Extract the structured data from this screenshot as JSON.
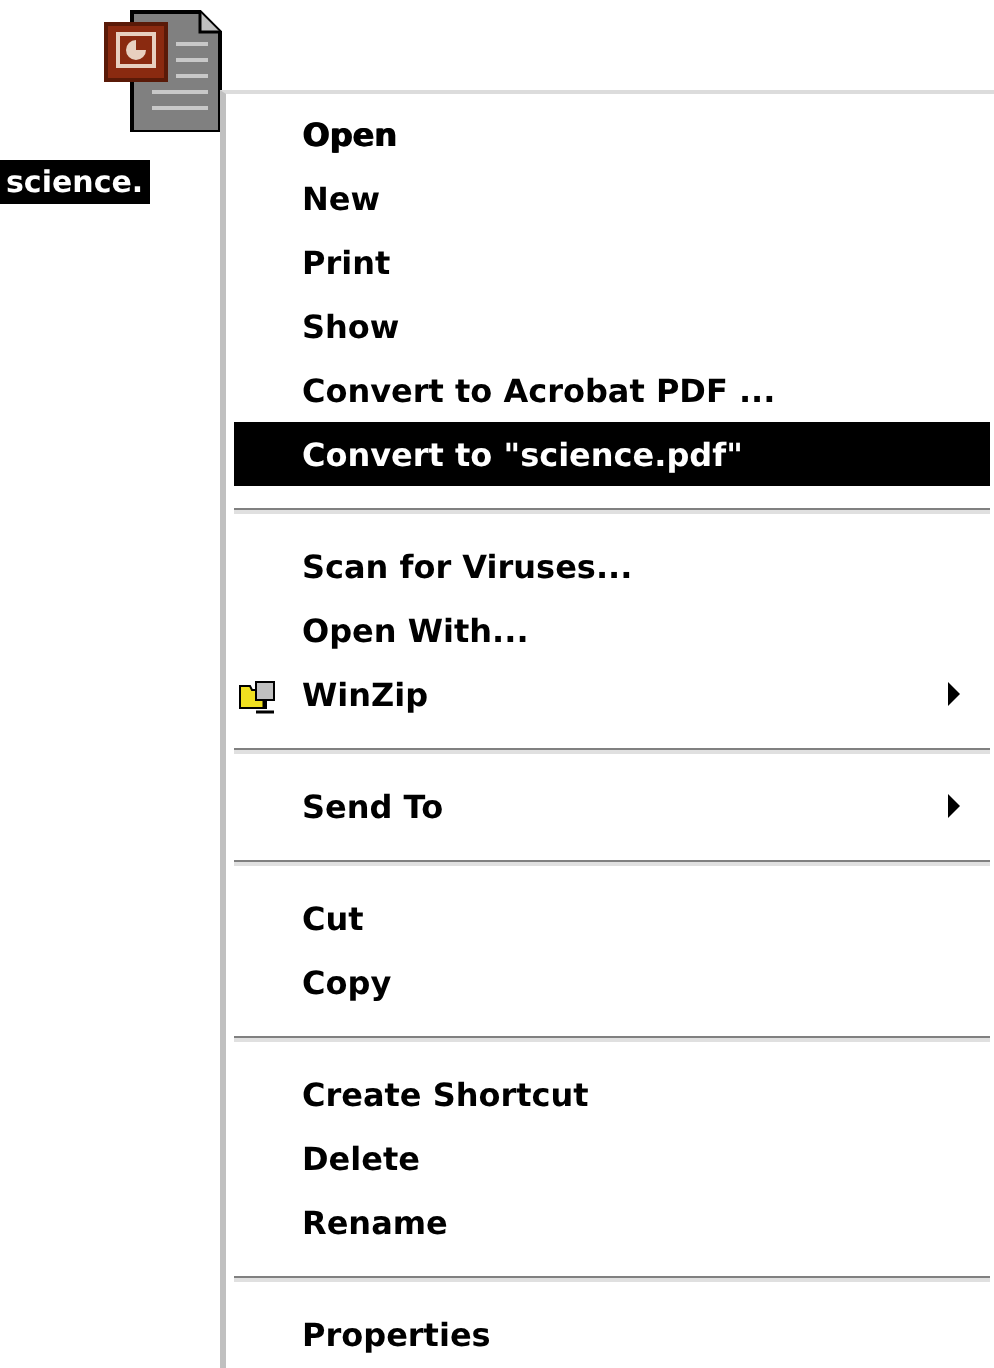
{
  "file": {
    "label": "science.",
    "selected": true
  },
  "context_menu": {
    "items": [
      {
        "kind": "item",
        "label": "Open",
        "default": true,
        "selected": false,
        "submenu": false,
        "icon": false
      },
      {
        "kind": "item",
        "label": "New",
        "default": false,
        "selected": false,
        "submenu": false,
        "icon": false
      },
      {
        "kind": "item",
        "label": "Print",
        "default": false,
        "selected": false,
        "submenu": false,
        "icon": false
      },
      {
        "kind": "item",
        "label": "Show",
        "default": false,
        "selected": false,
        "submenu": false,
        "icon": false
      },
      {
        "kind": "item",
        "label": "Convert to Acrobat PDF ...",
        "default": false,
        "selected": false,
        "submenu": false,
        "icon": false
      },
      {
        "kind": "item",
        "label": "Convert to \"science.pdf\"",
        "default": false,
        "selected": true,
        "submenu": false,
        "icon": false
      },
      {
        "kind": "separator"
      },
      {
        "kind": "item",
        "label": "Scan for Viruses...",
        "default": false,
        "selected": false,
        "submenu": false,
        "icon": false
      },
      {
        "kind": "item",
        "label": "Open With...",
        "default": false,
        "selected": false,
        "submenu": false,
        "icon": false
      },
      {
        "kind": "item",
        "label": "WinZip",
        "default": false,
        "selected": false,
        "submenu": true,
        "icon": true
      },
      {
        "kind": "separator"
      },
      {
        "kind": "item",
        "label": "Send To",
        "default": false,
        "selected": false,
        "submenu": true,
        "icon": false
      },
      {
        "kind": "separator"
      },
      {
        "kind": "item",
        "label": "Cut",
        "default": false,
        "selected": false,
        "submenu": false,
        "icon": false
      },
      {
        "kind": "item",
        "label": "Copy",
        "default": false,
        "selected": false,
        "submenu": false,
        "icon": false
      },
      {
        "kind": "separator"
      },
      {
        "kind": "item",
        "label": "Create Shortcut",
        "default": false,
        "selected": false,
        "submenu": false,
        "icon": false
      },
      {
        "kind": "item",
        "label": "Delete",
        "default": false,
        "selected": false,
        "submenu": false,
        "icon": false
      },
      {
        "kind": "item",
        "label": "Rename",
        "default": false,
        "selected": false,
        "submenu": false,
        "icon": false
      },
      {
        "kind": "separator"
      },
      {
        "kind": "item",
        "label": "Properties",
        "default": false,
        "selected": false,
        "submenu": false,
        "icon": false
      }
    ]
  }
}
